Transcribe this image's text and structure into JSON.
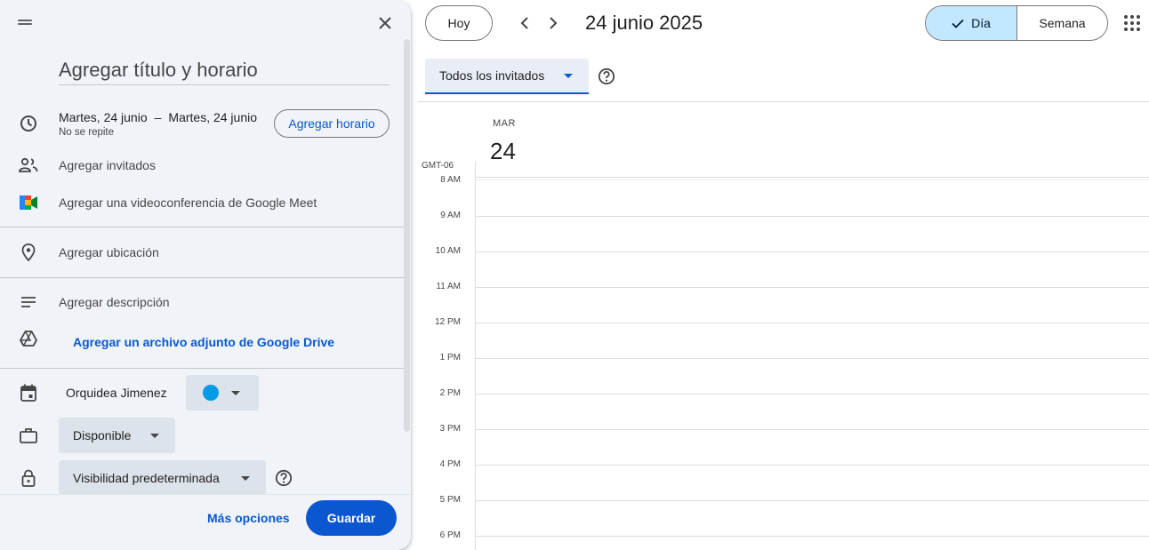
{
  "dialog": {
    "title_placeholder": "Agregar título y horario",
    "start_date": "Martes, 24 junio",
    "date_separator": "–",
    "end_date": "Martes, 24 junio",
    "repeat": "No se repite",
    "add_time_label": "Agregar horario",
    "add_guests": "Agregar invitados",
    "add_meet": "Agregar una videoconferencia de Google Meet",
    "add_location": "Agregar ubicación",
    "add_description": "Agregar descripción",
    "add_drive": "Agregar un archivo adjunto de Google Drive",
    "calendar_owner": "Orquidea Jimenez",
    "event_color": "#039be5",
    "availability": "Disponible",
    "visibility": "Visibilidad predeterminada",
    "more_options": "Más opciones",
    "save": "Guardar"
  },
  "toolbar": {
    "today": "Hoy",
    "date_title": "24 junio 2025",
    "view_day": "Día",
    "view_week": "Semana",
    "guests_filter": "Todos los invitados"
  },
  "day_view": {
    "weekday": "MAR",
    "day_number": "24",
    "timezone": "GMT-06",
    "hours": [
      "8 AM",
      "9 AM",
      "10 AM",
      "11 AM",
      "12 PM",
      "1 PM",
      "2 PM",
      "3 PM",
      "4 PM",
      "5 PM",
      "6 PM"
    ]
  },
  "colors": {
    "accent": "#0b57d0",
    "selected_view": "#c2e7ff",
    "dialog_background": "#f0f4f9"
  }
}
